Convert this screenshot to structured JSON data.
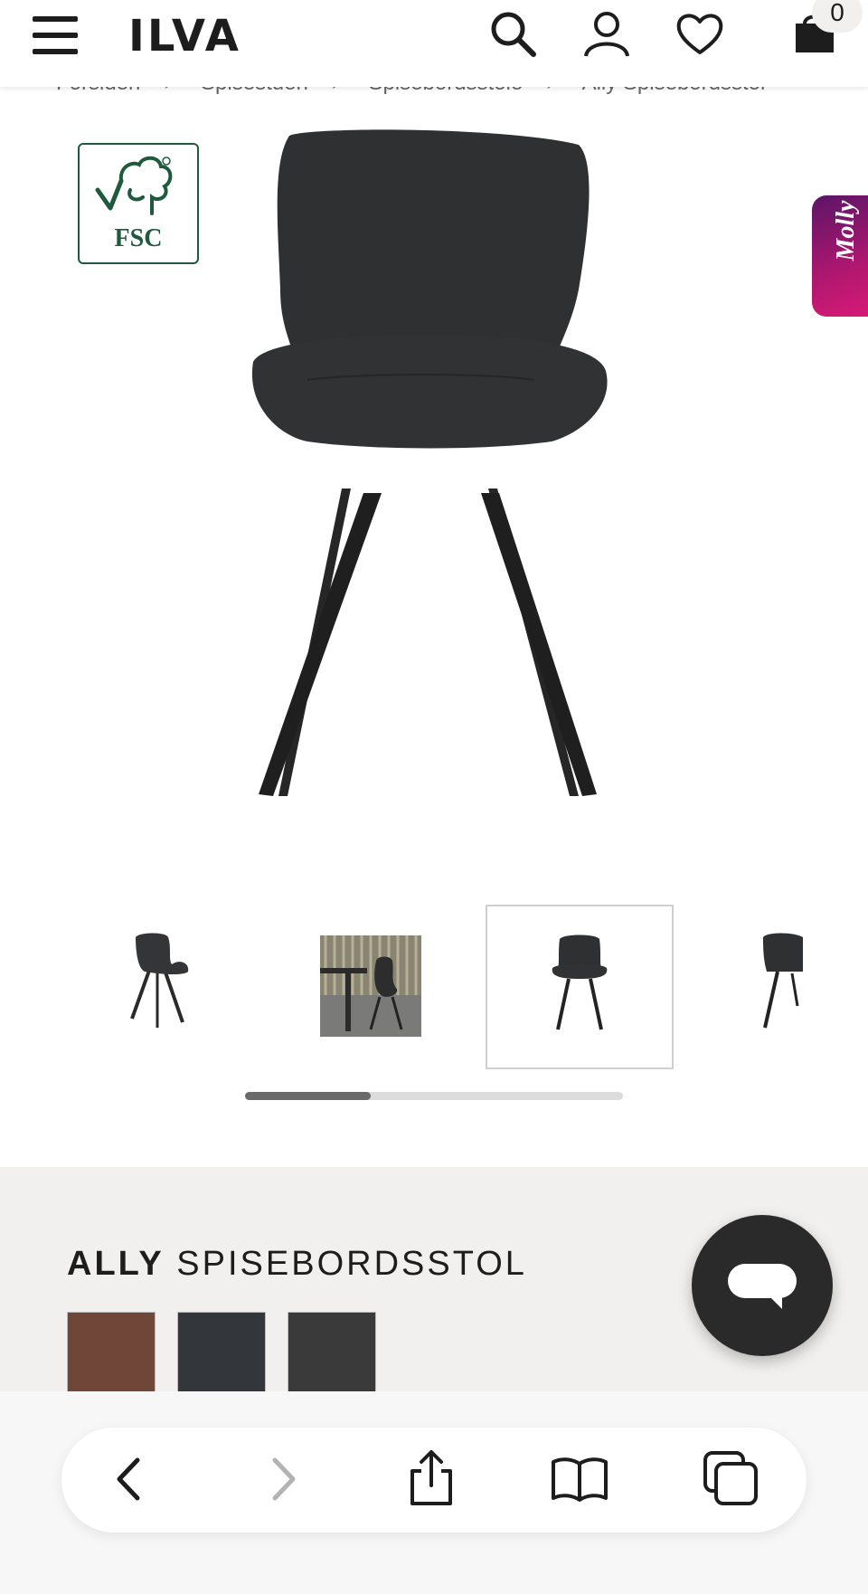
{
  "header": {
    "logo": "ILVA",
    "cart_count": "0"
  },
  "breadcrumb": {
    "items": [
      "Forsiden",
      "Spisestuen",
      "Spisebordsstole",
      "Ally Spisebordsstol"
    ]
  },
  "badges": {
    "fsc": "FSC",
    "molly": "Molly"
  },
  "product": {
    "name_bold": "ALLY",
    "name_rest": "SPISEBORDSSTOL"
  },
  "colors": {
    "brand_dark": "#1d1d1d",
    "fsc_green": "#1f5a3e",
    "molly_magenta": "#c2186f",
    "panel_bg": "#f1f0ee",
    "swatches": [
      "#6f4638",
      "#33373b",
      "#3a3a3a"
    ]
  },
  "icons": {
    "header": [
      "menu-icon",
      "search-icon",
      "account-icon",
      "heart-icon",
      "cart-icon"
    ],
    "browser": [
      "back-icon",
      "forward-icon",
      "share-icon",
      "bookmarks-icon",
      "tabs-icon"
    ],
    "chat": "chat-bubble-icon"
  },
  "gallery": {
    "thumbnail_count": 4,
    "active_index": 3,
    "scroll_position": 0.33
  }
}
